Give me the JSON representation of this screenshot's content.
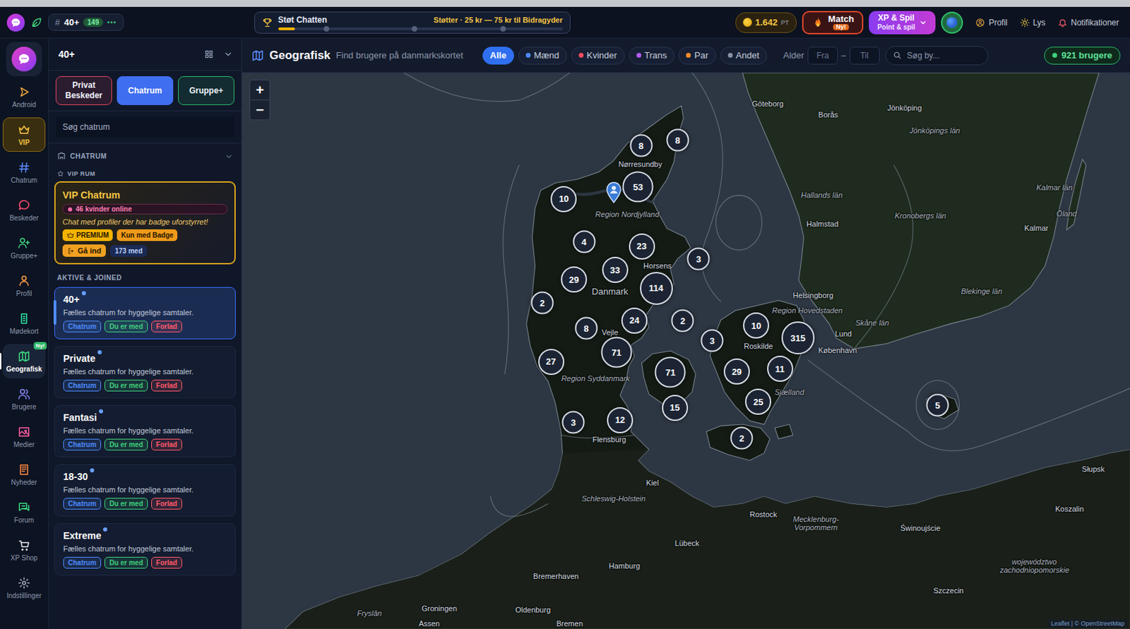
{
  "topbar": {
    "room": {
      "hash": "#",
      "name": "40+",
      "count": "149",
      "more": "•••"
    },
    "support": {
      "title": "Støt Chatten",
      "text": "Støtter · 25 kr — 75 kr til Bidragyder",
      "level": 0.06
    },
    "points": {
      "value": "1.642",
      "unit": "PT"
    },
    "match": {
      "label": "Match",
      "badge": "Ny!"
    },
    "xp": {
      "label": "XP & Spil",
      "sub": "Point & spil"
    },
    "links": [
      {
        "label": "Profil"
      },
      {
        "label": "Lys"
      },
      {
        "label": "Notifikationer"
      }
    ]
  },
  "rail": [
    {
      "label": "Android",
      "selected": false,
      "highlighted": false,
      "color": "#e8a33a"
    },
    {
      "label": "VIP",
      "selected": false,
      "highlighted": true,
      "color": "#f5c542"
    },
    {
      "label": "Chatrum",
      "selected": false,
      "highlighted": false,
      "color": "#5b8cff"
    },
    {
      "label": "Beskeder",
      "selected": false,
      "highlighted": false,
      "color": "#ff4d6d"
    },
    {
      "label": "Gruppe+",
      "selected": false,
      "highlighted": false,
      "color": "#3ddc84"
    },
    {
      "label": "Profil",
      "selected": false,
      "highlighted": false,
      "color": "#ff9f43"
    },
    {
      "label": "Mødekort",
      "selected": false,
      "highlighted": false,
      "color": "#2ee6a8"
    },
    {
      "label": "Geografisk",
      "selected": true,
      "highlighted": false,
      "color": "#3ddc84",
      "badge": "Ny!"
    },
    {
      "label": "Brugere",
      "selected": false,
      "highlighted": false,
      "color": "#8b8bff"
    },
    {
      "label": "Medier",
      "selected": false,
      "highlighted": false,
      "color": "#ff5fa2"
    },
    {
      "label": "Nyheder",
      "selected": false,
      "highlighted": false,
      "color": "#ff8c42"
    },
    {
      "label": "Forum",
      "selected": false,
      "highlighted": false,
      "color": "#3ddc84"
    },
    {
      "label": "XP Shop",
      "selected": false,
      "highlighted": false,
      "color": "#e8e8f0"
    },
    {
      "label": "Indstillinger",
      "selected": false,
      "highlighted": false,
      "color": "#aab0bc"
    }
  ],
  "panel": {
    "title": "40+",
    "tabs": [
      {
        "label": "Privat Beskeder",
        "selected": false,
        "color": "#e0475f"
      },
      {
        "label": "Chatrum",
        "selected": true,
        "color": "#3f6ef0"
      },
      {
        "label": "Gruppe+",
        "selected": false,
        "color": "#2fb86a"
      }
    ],
    "search_placeholder": "Søg chatrum",
    "section": "CHATRUM",
    "vip_header": "VIP RUM",
    "vip": {
      "title": "VIP Chatrum",
      "online": "46 kvinder online",
      "desc": "Chat med profiler der har badge uforstyrret!",
      "tags": [
        {
          "label": "PREMIUM",
          "color": "#f5b301"
        },
        {
          "label": "Kun med Badge",
          "color": "#f09a1a"
        }
      ],
      "enter": "Gå ind",
      "members": "173 med"
    },
    "joined_header": "AKTIVE & JOINED",
    "rooms": [
      {
        "name": "40+",
        "desc": "Fælles chatrum for hyggelige samtaler.",
        "selected": true,
        "tags": [
          {
            "label": "Chatrum",
            "color": "#4d8cff"
          },
          {
            "label": "Du er med",
            "color": "#3fcf7a"
          },
          {
            "label": "Forlad",
            "color": "#ff5a6a"
          }
        ]
      },
      {
        "name": "Private",
        "desc": "Fælles chatrum for hyggelige samtaler.",
        "selected": false,
        "tags": [
          {
            "label": "Chatrum",
            "color": "#4d8cff"
          },
          {
            "label": "Du er med",
            "color": "#3fcf7a"
          },
          {
            "label": "Forlad",
            "color": "#ff5a6a"
          }
        ]
      },
      {
        "name": "Fantasi",
        "desc": "Fælles chatrum for hyggelige samtaler.",
        "selected": false,
        "tags": [
          {
            "label": "Chatrum",
            "color": "#4d8cff"
          },
          {
            "label": "Du er med",
            "color": "#3fcf7a"
          },
          {
            "label": "Forlad",
            "color": "#ff5a6a"
          }
        ]
      },
      {
        "name": "18-30",
        "desc": "Fælles chatrum for hyggelige samtaler.",
        "selected": false,
        "tags": [
          {
            "label": "Chatrum",
            "color": "#4d8cff"
          },
          {
            "label": "Du er med",
            "color": "#3fcf7a"
          },
          {
            "label": "Forlad",
            "color": "#ff5a6a"
          }
        ]
      },
      {
        "name": "Extreme",
        "desc": "Fælles chatrum for hyggelige samtaler.",
        "selected": false,
        "tags": [
          {
            "label": "Chatrum",
            "color": "#4d8cff"
          },
          {
            "label": "Du er med",
            "color": "#3fcf7a"
          },
          {
            "label": "Forlad",
            "color": "#ff5a6a"
          }
        ]
      }
    ]
  },
  "map": {
    "title": "Geografisk",
    "subtitle": "Find brugere på danmarkskortet",
    "filters": [
      {
        "label": "Alle",
        "selected": true
      },
      {
        "label": "Mænd",
        "selected": false,
        "color": "#4d8cff"
      },
      {
        "label": "Kvinder",
        "selected": false,
        "color": "#ff4d5e"
      },
      {
        "label": "Trans",
        "selected": false,
        "color": "#b05cf0"
      },
      {
        "label": "Par",
        "selected": false,
        "color": "#ff8c2a"
      },
      {
        "label": "Andet",
        "selected": false,
        "color": "#8a93a6"
      }
    ],
    "age": {
      "label": "Alder",
      "from": "Fra",
      "sep": "–",
      "to": "Til"
    },
    "search_placeholder": "Søg by...",
    "count": "921 brugere",
    "zoom": [
      "+",
      "−"
    ],
    "clusters": [
      {
        "count": "8"
      },
      {
        "count": "8"
      },
      {
        "count": "10"
      },
      {
        "count": "53"
      },
      {
        "count": "4"
      },
      {
        "count": "23"
      },
      {
        "count": "3"
      },
      {
        "count": "29"
      },
      {
        "count": "33"
      },
      {
        "count": "114"
      },
      {
        "count": "2"
      },
      {
        "count": "8"
      },
      {
        "count": "24"
      },
      {
        "count": "2"
      },
      {
        "count": "10"
      },
      {
        "count": "315"
      },
      {
        "count": "3"
      },
      {
        "count": "27"
      },
      {
        "count": "71"
      },
      {
        "count": "71"
      },
      {
        "count": "29"
      },
      {
        "count": "11"
      },
      {
        "count": "15"
      },
      {
        "count": "25"
      },
      {
        "count": "3"
      },
      {
        "count": "12"
      },
      {
        "count": "2"
      },
      {
        "count": "5"
      }
    ],
    "labels": [
      {
        "text": "Göteborg",
        "kind": "city"
      },
      {
        "text": "Borås",
        "kind": "city"
      },
      {
        "text": "Jönköping",
        "kind": "city"
      },
      {
        "text": "Jönköpings län",
        "kind": "region"
      },
      {
        "text": "Hallands län",
        "kind": "region"
      },
      {
        "text": "Halmstad",
        "kind": "city"
      },
      {
        "text": "Kronobergs län",
        "kind": "region"
      },
      {
        "text": "Kalmar län",
        "kind": "region"
      },
      {
        "text": "Öland",
        "kind": "region"
      },
      {
        "text": "Kalmar",
        "kind": "city"
      },
      {
        "text": "Blekinge län",
        "kind": "region"
      },
      {
        "text": "Skåne län",
        "kind": "region"
      },
      {
        "text": "Helsingborg",
        "kind": "city"
      },
      {
        "text": "Lund",
        "kind": "city"
      },
      {
        "text": "Region Hovedstaden",
        "kind": "area"
      },
      {
        "text": "Roskilde",
        "kind": "city"
      },
      {
        "text": "København",
        "kind": "city"
      },
      {
        "text": "Region Nordjylland",
        "kind": "area"
      },
      {
        "text": "Danmark",
        "kind": "country"
      },
      {
        "text": "Vejle",
        "kind": "city"
      },
      {
        "text": "Horsens",
        "kind": "city"
      },
      {
        "text": "Nørresundby",
        "kind": "city"
      },
      {
        "text": "Region Syddanmark",
        "kind": "area"
      },
      {
        "text": "Sjælland",
        "kind": "area"
      },
      {
        "text": "Flensburg",
        "kind": "city"
      },
      {
        "text": "Kiel",
        "kind": "city"
      },
      {
        "text": "Schleswig-Holstein",
        "kind": "region"
      },
      {
        "text": "Lübeck",
        "kind": "city"
      },
      {
        "text": "Rostock",
        "kind": "city"
      },
      {
        "text": "Mecklenburg-Vorpommern",
        "kind": "region"
      },
      {
        "text": "Hamburg",
        "kind": "city"
      },
      {
        "text": "Bremerhaven",
        "kind": "city"
      },
      {
        "text": "Oldenburg",
        "kind": "city"
      },
      {
        "text": "Bremen",
        "kind": "city"
      },
      {
        "text": "Groningen",
        "kind": "city"
      },
      {
        "text": "Assen",
        "kind": "city"
      },
      {
        "text": "Fryslân",
        "kind": "region"
      },
      {
        "text": "Świnoujście",
        "kind": "city"
      },
      {
        "text": "Szczecin",
        "kind": "city"
      },
      {
        "text": "Koszalin",
        "kind": "city"
      },
      {
        "text": "Słupsk",
        "kind": "city"
      },
      {
        "text": "województwo zachodniopomorskie",
        "kind": "region"
      }
    ],
    "attribution": "Leaflet | © OpenStreetMap"
  }
}
